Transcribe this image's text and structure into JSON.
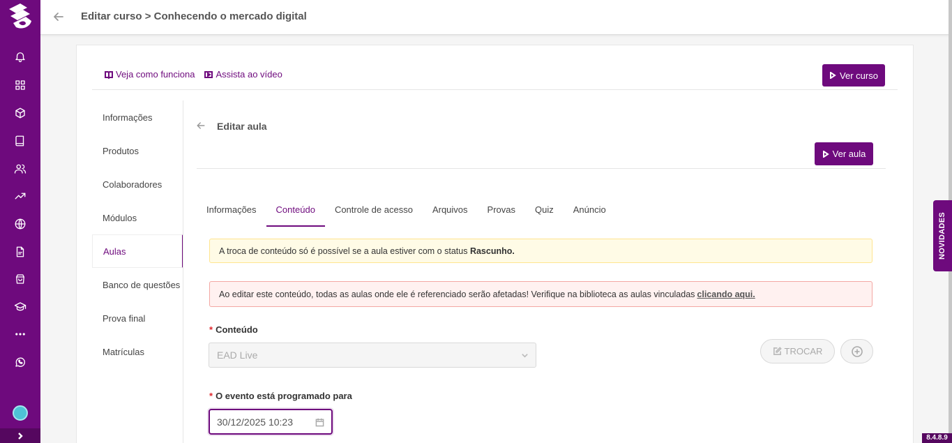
{
  "header": {
    "title": "Editar curso > Conhecendo o mercado digital"
  },
  "sidebar": {
    "icons": [
      "logo-icon",
      "bell-icon",
      "dashboard-icon",
      "cube-icon",
      "book-icon",
      "users-icon",
      "trending-icon",
      "globe-icon",
      "document-icon",
      "shopping-bag-icon",
      "graduation-cap-icon",
      "more-icon",
      "whatsapp-icon"
    ]
  },
  "card": {
    "link_how": "Veja como funciona",
    "link_video": "Assista ao vídeo",
    "ver_curso": "Ver curso"
  },
  "menu": {
    "items": [
      {
        "label": "Informações"
      },
      {
        "label": "Produtos"
      },
      {
        "label": "Colaboradores"
      },
      {
        "label": "Módulos"
      },
      {
        "label": "Aulas",
        "active": true
      },
      {
        "label": "Banco de questões"
      },
      {
        "label": "Prova final"
      },
      {
        "label": "Matrículas"
      }
    ]
  },
  "aula": {
    "title": "Editar aula",
    "ver_aula": "Ver aula"
  },
  "tabs": [
    {
      "label": "Informações"
    },
    {
      "label": "Conteúdo",
      "active": true
    },
    {
      "label": "Controle de acesso"
    },
    {
      "label": "Arquivos"
    },
    {
      "label": "Provas"
    },
    {
      "label": "Quiz"
    },
    {
      "label": "Anúncio"
    }
  ],
  "alerts": {
    "warn_text": "A troca de conteúdo só é possível se a aula estiver com o status",
    "warn_bold": "Rascunho.",
    "err_text": "Ao editar este conteúdo, todas as aulas onde ele é referenciado serão afetadas! Verifique na biblioteca as aulas vinculadas",
    "err_link": "clicando aqui."
  },
  "form": {
    "content_label": "Conteúdo",
    "content_value": "EAD Live",
    "trocar_label": "TROCAR",
    "event_label": "O evento está programado para",
    "event_value": "30/12/2025 10:23",
    "required_mark": "*"
  },
  "novidades": "NOVIDADES",
  "version": "8.4.8.9",
  "colors": {
    "brand": "#6e0a7d",
    "warn_bg": "#fffbe6",
    "err_bg": "#fff1f0"
  }
}
